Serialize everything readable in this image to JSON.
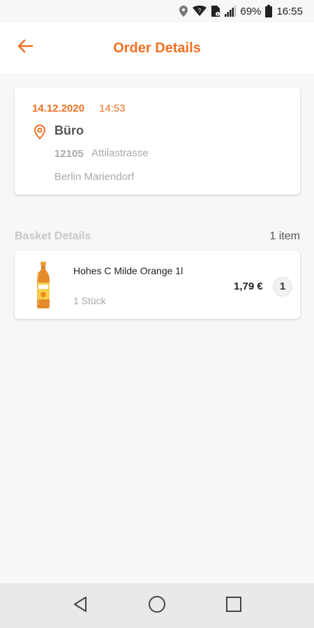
{
  "status_bar": {
    "battery_percent": "69%",
    "time": "16:55",
    "icons": [
      "location-icon",
      "wifi-icon",
      "sim-icon",
      "signal-icon",
      "battery-icon"
    ]
  },
  "header": {
    "title": "Order Details",
    "back_icon": "back-arrow-icon"
  },
  "order": {
    "date": "14.12.2020",
    "time": "14:53",
    "address_name": "Büro",
    "postcode": "12105",
    "street": "Attilastrasse",
    "city": "Berlin Mariendorf"
  },
  "basket": {
    "title": "Basket Details",
    "count": "1 item",
    "items": [
      {
        "name": "Hohes C Milde Orange 1l",
        "quantity_label": "1 Stück",
        "price": "1,79 €",
        "count": "1"
      }
    ]
  },
  "colors": {
    "accent": "#f26f21",
    "background": "#f7f7f7"
  },
  "nav": {
    "icons": [
      "back-triangle-icon",
      "home-circle-icon",
      "recents-square-icon"
    ]
  }
}
